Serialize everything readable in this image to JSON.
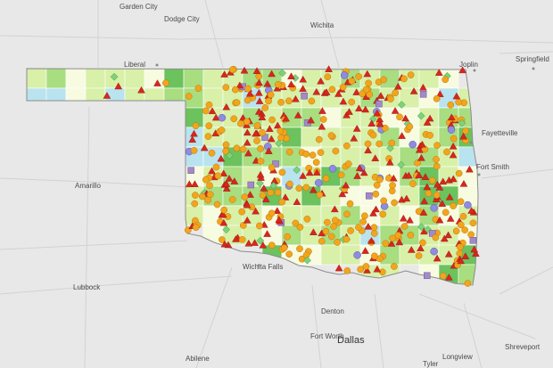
{
  "map": {
    "region": "Oklahoma",
    "base_color": "#e8e8e8",
    "road_color": "#d2d2d2",
    "fill_classes": [
      "#f7fbe0",
      "#d8f0a8",
      "#a8dd80",
      "#6cc25c",
      "#b9e3ee"
    ],
    "marker_colors": {
      "circle": "#f2a51c",
      "triangle": "#d8261c",
      "circle_alt": "#8f8be0",
      "square": "#a389c9",
      "diamond": "#7ed27a"
    }
  },
  "cities": [
    {
      "id": "garden-city",
      "label": "Garden City"
    },
    {
      "id": "dodge-city",
      "label": "Dodge City"
    },
    {
      "id": "wichita",
      "label": "Wichita"
    },
    {
      "id": "liberal",
      "label": "Liberal"
    },
    {
      "id": "joplin",
      "label": "Joplin"
    },
    {
      "id": "springfield",
      "label": "Springfield"
    },
    {
      "id": "fayetteville",
      "label": "Fayetteville"
    },
    {
      "id": "fort-smith",
      "label": "Fort Smith"
    },
    {
      "id": "amarillo",
      "label": "Amarillo"
    },
    {
      "id": "wichita-falls",
      "label": "Wichita Falls"
    },
    {
      "id": "lubbock",
      "label": "Lubbock"
    },
    {
      "id": "denton",
      "label": "Denton"
    },
    {
      "id": "fort-worth",
      "label": "Fort Worth"
    },
    {
      "id": "dallas",
      "label": "Dallas"
    },
    {
      "id": "abilene",
      "label": "Abilene"
    },
    {
      "id": "tyler",
      "label": "Tyler"
    },
    {
      "id": "longview",
      "label": "Longview"
    },
    {
      "id": "shreveport",
      "label": "Shreveport"
    }
  ]
}
